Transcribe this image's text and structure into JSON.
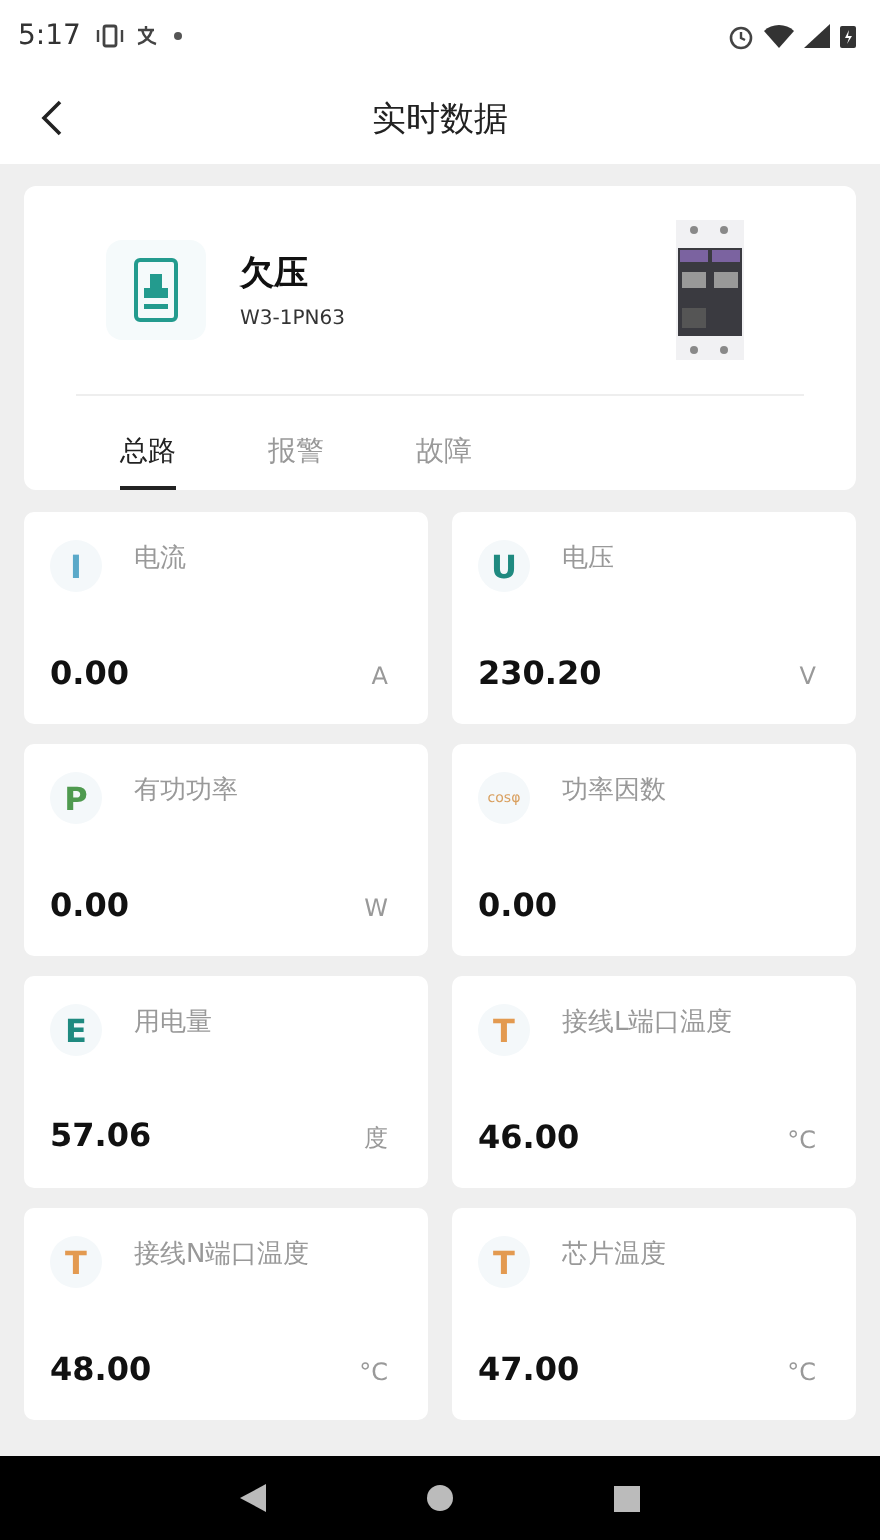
{
  "status_bar": {
    "time": "5:17"
  },
  "header": {
    "title": "实时数据"
  },
  "device": {
    "name": "欠压",
    "model": "W3-1PN63"
  },
  "tabs": [
    {
      "label": "总路",
      "selected": true
    },
    {
      "label": "报警",
      "selected": false
    },
    {
      "label": "故障",
      "selected": false
    }
  ],
  "metrics": [
    {
      "symbol": "I",
      "color": "#5aa9c9",
      "label": "电流",
      "value": "0.00",
      "unit": "A"
    },
    {
      "symbol": "U",
      "color": "#1f8a80",
      "label": "电压",
      "value": "230.20",
      "unit": "V"
    },
    {
      "symbol": "P",
      "color": "#4f9a4f",
      "label": "有功功率",
      "value": "0.00",
      "unit": "W"
    },
    {
      "symbol": "cosφ",
      "color": "#d9a060",
      "label": "功率因数",
      "value": "0.00"
    },
    {
      "symbol": "E",
      "color": "#1f8a80",
      "label": "用电量",
      "value": "57.06",
      "unit": "度"
    },
    {
      "symbol": "T",
      "color": "#e39a50",
      "label": "接线L端口温度",
      "value": "46.00",
      "unit": "°C"
    },
    {
      "symbol": "T",
      "color": "#e39a50",
      "label": "接线N端口温度",
      "value": "48.00",
      "unit": "°C"
    },
    {
      "symbol": "T",
      "color": "#e39a50",
      "label": "芯片温度",
      "value": "47.00",
      "unit": "°C"
    }
  ]
}
